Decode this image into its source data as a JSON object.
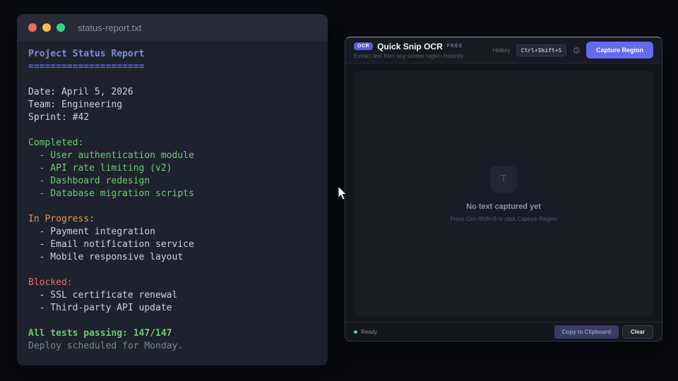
{
  "editor_window": {
    "title": "status-report.txt",
    "traffic_lights": [
      {
        "name": "close-button",
        "color": "#ee6a5f"
      },
      {
        "name": "minimize-button",
        "color": "#f4bf4f"
      },
      {
        "name": "maximize-button",
        "color": "#32d583"
      }
    ],
    "lines": [
      {
        "text": "Project Status Report",
        "style": "heading"
      },
      {
        "text": "=====================",
        "style": "underline"
      },
      {
        "text": "",
        "style": "plain"
      },
      {
        "text": "Date: April 5, 2026",
        "style": "plain"
      },
      {
        "text": "Team: Engineering",
        "style": "plain"
      },
      {
        "text": "Sprint: #42",
        "style": "plain"
      },
      {
        "text": "",
        "style": "plain"
      },
      {
        "text": "Completed:",
        "style": "green"
      },
      {
        "text": "  - User authentication module",
        "style": "green"
      },
      {
        "text": "  - API rate limiting (v2)",
        "style": "green"
      },
      {
        "text": "  - Dashboard redesign",
        "style": "green"
      },
      {
        "text": "  - Database migration scripts",
        "style": "green"
      },
      {
        "text": "",
        "style": "plain"
      },
      {
        "text": "In Progress:",
        "style": "orange"
      },
      {
        "text": "  - Payment integration",
        "style": "plain"
      },
      {
        "text": "  - Email notification service",
        "style": "plain"
      },
      {
        "text": "  - Mobile responsive layout",
        "style": "plain"
      },
      {
        "text": "",
        "style": "plain"
      },
      {
        "text": "Blocked:",
        "style": "red"
      },
      {
        "text": "  - SSL certificate renewal",
        "style": "plain"
      },
      {
        "text": "  - Third-party API update",
        "style": "plain"
      },
      {
        "text": "",
        "style": "plain"
      },
      {
        "text": "All tests passing: 147/147",
        "style": "green-bold"
      },
      {
        "text": "Deploy scheduled for Monday.",
        "style": "dim"
      }
    ]
  },
  "ocr_window": {
    "badge": "OCR",
    "title": "Quick Snip OCR",
    "plan_badge": "FREE",
    "subtitle": "Extract text from any screen region instantly",
    "hotkey_label": "Hotkey",
    "hotkey": "Ctrl+Shift+S",
    "gear_glyph": "⚙",
    "capture_button": "Capture Region",
    "empty_state": {
      "icon_glyph": "T",
      "title": "No text captured yet",
      "hint": "Press Ctrl+Shift+S or click Capture Region"
    },
    "footer": {
      "status": "Ready",
      "copy_button": "Copy to Clipboard",
      "clear_button": "Clear"
    }
  },
  "colors": {
    "page_background": "#0a0b10",
    "accent_indigo": "#666af0",
    "status_green": "#34d399"
  }
}
